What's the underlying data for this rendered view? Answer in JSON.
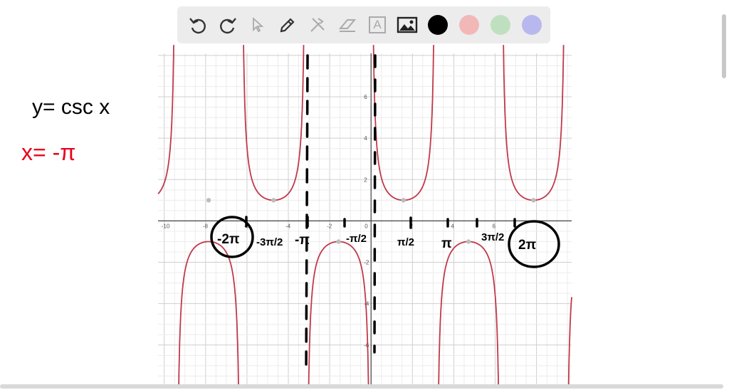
{
  "toolbar": {
    "tools": [
      "undo-icon",
      "redo-icon",
      "pointer-icon",
      "pen-icon",
      "tools-icon",
      "eraser-icon",
      "text-icon",
      "image-icon"
    ],
    "text_tool_label": "A",
    "colors": [
      "#000000",
      "#f2b8b8",
      "#bfe0bf",
      "#b8b8ee"
    ]
  },
  "annotations": {
    "equation": "y= csc x",
    "asymptote": "x= -π",
    "labels": [
      "-2π",
      "-3π/2",
      "-π",
      "-π/2",
      "π/2",
      "π",
      "3π/2",
      "2π"
    ],
    "ink_color": "#000000",
    "highlight_color": "#e8001c"
  },
  "chart_data": {
    "type": "line",
    "function": "csc(x)",
    "series": [
      {
        "name": "y = csc x",
        "color": "#c0394b"
      }
    ],
    "xlim": [
      -10.3,
      9.7
    ],
    "ylim": [
      -7.9,
      8.1
    ],
    "x_ticks": [
      "-10",
      "-8",
      "-6",
      "-4",
      "-2",
      "0",
      "2",
      "4",
      "6"
    ],
    "y_ticks": [
      "-6",
      "-4",
      "-2",
      "2",
      "4",
      "6"
    ],
    "grid": true,
    "extrema_points": [
      [
        -7.854,
        1
      ],
      [
        -4.712,
        1
      ],
      [
        -1.571,
        -1
      ],
      [
        1.571,
        1
      ],
      [
        4.712,
        -1
      ],
      [
        7.854,
        1
      ]
    ]
  }
}
